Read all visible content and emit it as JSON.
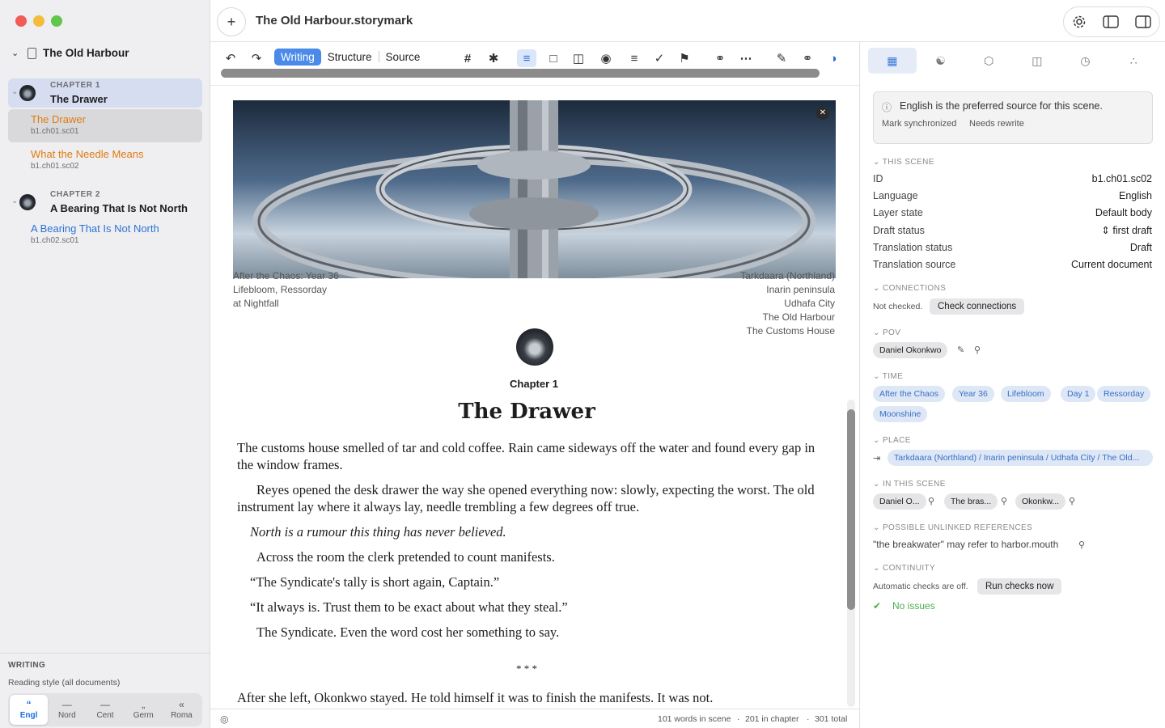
{
  "window": {
    "title": "The Old Harbour.storymark"
  },
  "sidebar": {
    "book_title": "The Old Harbour",
    "chapters": [
      {
        "label": "CHAPTER 1",
        "title": "The Drawer",
        "scenes": [
          {
            "title": "The Drawer",
            "id": "b1.ch01.sc01"
          },
          {
            "title": "What the Needle Means",
            "id": "b1.ch01.sc02"
          }
        ]
      },
      {
        "label": "CHAPTER 2",
        "title": "A Bearing That Is Not North",
        "scenes": [
          {
            "title": "A Bearing That Is Not North",
            "id": "b1.ch02.sc01"
          }
        ]
      }
    ],
    "writing_header": "WRITING",
    "reading_style_label": "Reading style (all documents)",
    "reading_styles": [
      {
        "glyph": "“",
        "label": "Engl",
        "active": true
      },
      {
        "glyph": "—",
        "label": "Nord"
      },
      {
        "glyph": "—",
        "label": "Cent"
      },
      {
        "glyph": "„",
        "label": "Germ"
      },
      {
        "glyph": "«",
        "label": "Roma"
      }
    ]
  },
  "toolbar": {
    "modes": [
      "Writing",
      "Structure",
      "Source"
    ],
    "active_mode": "Writing"
  },
  "editor": {
    "meta_left": [
      "After the Chaos: Year 36",
      "Lifebloom, Ressorday",
      "at Nightfall"
    ],
    "meta_right": [
      "Tarkdaara (Northland)",
      "Inarin peninsula",
      "Udhafa City",
      "The Old Harbour",
      "The Customs House"
    ],
    "chapter_label": "Chapter 1",
    "scene_title": "The Drawer",
    "paragraphs": [
      "The customs house smelled of tar and cold coffee. Rain came sideways off the water and found every gap in the window frames.",
      "Reyes opened the desk drawer the way she opened everything now: slowly, expecting the worst. The old instrument lay where it always lay, needle trembling a few degrees off true.",
      "North is a rumour this thing has never believed.",
      "Across the room the clerk pretended to count manifests.",
      "“The Syndicate's tally is short again, Captain.”",
      "“It always is. Trust them to be exact about what they steal.”",
      "The Syndicate. Even the word cost her something to say.",
      "* * *",
      "After she left, Okonkwo stayed. He told himself it was to finish the manifests. It was not."
    ]
  },
  "status": {
    "words_scene": "101 words in scene",
    "words_chapter": "201 in chapter",
    "words_total": "301 total"
  },
  "inspector": {
    "notice": "English is the preferred source for this scene.",
    "notice_actions": [
      "Mark synchronized",
      "Needs rewrite"
    ],
    "this_scene_header": "THIS SCENE",
    "fields": [
      {
        "key": "ID",
        "value": "b1.ch01.sc02"
      },
      {
        "key": "Language",
        "value": "English"
      },
      {
        "key": "Layer state",
        "value": "Default body"
      },
      {
        "key": "Draft status",
        "value": "first draft"
      },
      {
        "key": "Translation status",
        "value": "Draft"
      },
      {
        "key": "Translation source",
        "value": "Current document"
      }
    ],
    "connections_header": "CONNECTIONS",
    "connections_note": "Not checked.",
    "connections_button": "Check connections",
    "pov_header": "POV",
    "pov": "Daniel Okonkwo",
    "time_header": "TIME",
    "time_tags": [
      "After the Chaos",
      "Year 36",
      "Lifebloom",
      "Day 1",
      "Ressorday",
      "Moonshine"
    ],
    "place_header": "PLACE",
    "place": "Tarkdaara (Northland) / Inarin peninsula / Udhafa City / The Old...",
    "in_scene_header": "IN THIS SCENE",
    "in_scene": [
      "Daniel O...",
      "The bras...",
      "Okonkw..."
    ],
    "unlinked_header": "POSSIBLE UNLINKED REFERENCES",
    "unlinked": "\"the breakwater\" may refer to harbor.mouth",
    "continuity_header": "CONTINUITY",
    "continuity_note": "Automatic checks are off.",
    "continuity_button": "Run checks now",
    "continuity_status": "No issues"
  },
  "colors": {
    "accent": "#4a8ae8",
    "scene_active": "#e07b10",
    "scene_link": "#2a74d6",
    "ok": "#4cae4c"
  }
}
